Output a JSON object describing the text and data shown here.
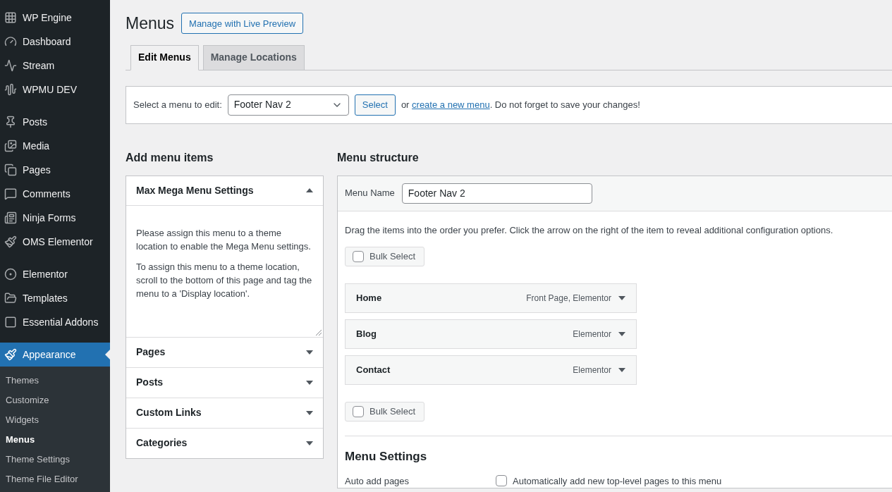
{
  "sidebar": {
    "sections": [
      {
        "items": [
          {
            "label": "WP Engine",
            "selected": false
          },
          {
            "label": "Dashboard",
            "selected": false
          },
          {
            "label": "Stream",
            "selected": false
          },
          {
            "label": "WPMU DEV",
            "selected": false
          }
        ]
      },
      {
        "items": [
          {
            "label": "Posts",
            "selected": false
          },
          {
            "label": "Media",
            "selected": false
          },
          {
            "label": "Pages",
            "selected": false
          },
          {
            "label": "Comments",
            "selected": false
          },
          {
            "label": "Ninja Forms",
            "selected": false
          },
          {
            "label": "OMS Elementor",
            "selected": false
          }
        ]
      },
      {
        "items": [
          {
            "label": "Elementor",
            "selected": false
          },
          {
            "label": "Templates",
            "selected": false
          },
          {
            "label": "Essential Addons",
            "selected": false
          }
        ]
      },
      {
        "items": [
          {
            "label": "Appearance",
            "selected": true
          }
        ]
      }
    ],
    "submenu": [
      {
        "label": "Themes",
        "selected": false
      },
      {
        "label": "Customize",
        "selected": false
      },
      {
        "label": "Widgets",
        "selected": false
      },
      {
        "label": "Menus",
        "selected": true
      },
      {
        "label": "Theme Settings",
        "selected": false
      },
      {
        "label": "Theme File Editor",
        "selected": false
      }
    ]
  },
  "page": {
    "title": "Menus",
    "action_button": "Manage with Live Preview"
  },
  "tabs": [
    {
      "label": "Edit Menus",
      "selected": true
    },
    {
      "label": "Manage Locations",
      "selected": false
    }
  ],
  "menu_picker": {
    "label": "Select a menu to edit:",
    "value": "Footer Nav 2",
    "button": "Select",
    "text_before_link": "or",
    "link": "create a new menu",
    "text_after_link": ". Do not forget to save your changes!"
  },
  "add_items": {
    "heading": "Add menu items",
    "sections": [
      {
        "title": "Max Mega Menu Settings",
        "expanded": true,
        "paragraphs": [
          "Please assign this menu to a theme location to enable the Mega Menu settings.",
          "To assign this menu to a theme location, scroll to the bottom of this page and tag the menu to a 'Display location'."
        ]
      },
      {
        "title": "Pages",
        "expanded": false
      },
      {
        "title": "Posts",
        "expanded": false
      },
      {
        "title": "Custom Links",
        "expanded": false
      },
      {
        "title": "Categories",
        "expanded": false
      }
    ]
  },
  "structure": {
    "heading": "Menu structure",
    "name_label": "Menu Name",
    "name_value": "Footer Nav 2",
    "instructions": "Drag the items into the order you prefer. Click the arrow on the right of the item to reveal additional configuration options.",
    "bulk_select_top": {
      "label": "Bulk Select",
      "checked": false
    },
    "items": [
      {
        "title": "Home",
        "meta": "Front Page, Elementor"
      },
      {
        "title": "Blog",
        "meta": "Elementor"
      },
      {
        "title": "Contact",
        "meta": "Elementor"
      }
    ],
    "bulk_select_bottom": {
      "label": "Bulk Select",
      "checked": false
    },
    "settings_heading": "Menu Settings",
    "settings": [
      {
        "label": "Auto add pages",
        "option": "Automatically add new top-level pages to this menu",
        "checked": false
      }
    ]
  }
}
